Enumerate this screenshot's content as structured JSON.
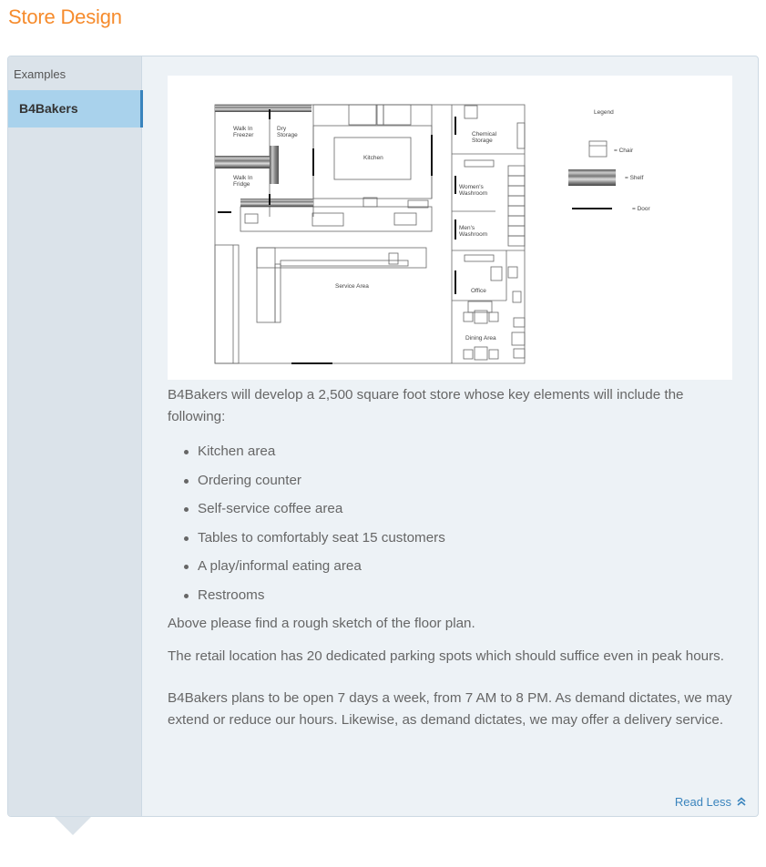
{
  "page": {
    "title": "Store Design"
  },
  "sidebar": {
    "header": "Examples",
    "items": [
      {
        "label": "B4Bakers",
        "active": true
      }
    ]
  },
  "floorplan": {
    "rooms": {
      "walk_in_freezer": "Walk In Freezer",
      "dry_storage": "Dry Storage",
      "kitchen": "Kitchen",
      "walk_in_fridge": "Walk In Fridge",
      "chemical_storage": "Chemical Storage",
      "womens_washroom": "Women's Washroom",
      "mens_washroom": "Men's Washroom",
      "service_area": "Service Area",
      "office": "Office",
      "dining_area": "Dining Area"
    },
    "legend": {
      "title": "Legend",
      "items": [
        {
          "symbol": "chair",
          "label": "= Chair"
        },
        {
          "symbol": "shelf",
          "label": "= Shelf"
        },
        {
          "symbol": "door",
          "label": "= Door"
        }
      ]
    }
  },
  "content": {
    "intro": "B4Bakers will develop a 2,500 square foot store whose key elements will include the following:",
    "bullets": [
      "Kitchen area",
      "Ordering counter",
      "Self-service coffee area",
      "Tables to comfortably seat 15 customers",
      "A play/informal eating area",
      "Restrooms"
    ],
    "sketch_note": "Above please find a rough sketch of the floor plan.",
    "parking": "The retail location has 20 dedicated parking spots which should suffice even in peak hours.",
    "hours": "B4Bakers plans to be open 7 days a week, from 7 AM to 8 PM. As demand dictates, we may extend or reduce our hours. Likewise, as demand dictates, we may offer a delivery service."
  },
  "actions": {
    "read_less_label": "Read Less",
    "read_less_icon": "double-chevron-up-icon"
  },
  "colors": {
    "title_orange": "#f68b2c",
    "accent_blue": "#3a84bd",
    "active_item_bg": "#a9d2ec",
    "sidebar_bg": "#dbe3ea",
    "content_bg": "#edf2f6"
  }
}
